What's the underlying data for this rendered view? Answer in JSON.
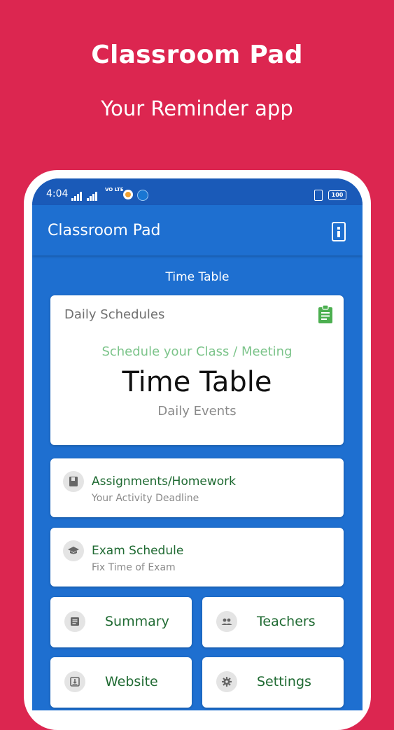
{
  "promo": {
    "title": "Classroom Pad",
    "subtitle": "Your Reminder app"
  },
  "status_bar": {
    "time": "4:04",
    "network_label": "VO LTE",
    "battery": "100"
  },
  "app_bar": {
    "title": "Classroom Pad",
    "info_icon": "info-icon"
  },
  "section": {
    "title": "Time Table"
  },
  "hero_card": {
    "label": "Daily Schedules",
    "icon": "clipboard-icon",
    "tagline": "Schedule your Class / Meeting",
    "main": "Time Table",
    "sub": "Daily Events"
  },
  "list_cards": [
    {
      "title": "Assignments/Homework",
      "subtitle": "Your Activity Deadline",
      "icon": "book-icon"
    },
    {
      "title": "Exam Schedule",
      "subtitle": "Fix Time of Exam",
      "icon": "graduation-cap-icon"
    }
  ],
  "tiles": [
    {
      "label": "Summary",
      "icon": "summary-icon"
    },
    {
      "label": "Teachers",
      "icon": "people-icon"
    },
    {
      "label": "Website",
      "icon": "download-box-icon"
    },
    {
      "label": "Settings",
      "icon": "gear-icon"
    }
  ],
  "colors": {
    "background": "#DC2650",
    "app_blue": "#1E6FD0",
    "status_blue": "#1A5AB8",
    "green_text": "#1F6A32",
    "tagline_green": "#7CC48A",
    "clipboard_green": "#4CAF50"
  }
}
